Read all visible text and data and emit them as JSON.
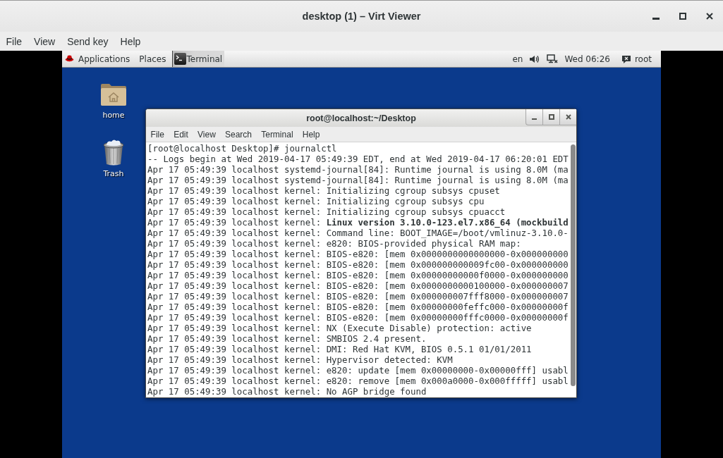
{
  "window": {
    "title": "desktop (1) – Virt Viewer",
    "menu": [
      "File",
      "View",
      "Send key",
      "Help"
    ]
  },
  "top_panel": {
    "applications": "Applications",
    "places": "Places",
    "task": "Terminal",
    "keyboard": "en",
    "clock": "Wed 06:26",
    "user": "root"
  },
  "desktop_icons": [
    {
      "kind": "folder",
      "label": "home"
    },
    {
      "kind": "trash",
      "label": "Trash"
    }
  ],
  "terminal": {
    "title": "root@localhost:~/Desktop",
    "menu": [
      "File",
      "Edit",
      "View",
      "Search",
      "Terminal",
      "Help"
    ],
    "lines": [
      "[root@localhost Desktop]# journalctl",
      "-- Logs begin at Wed 2019-04-17 05:49:39 EDT, end at Wed 2019-04-17 06:20:01 EDT",
      "Apr 17 05:49:39 localhost systemd-journal[84]: Runtime journal is using 8.0M (ma",
      "Apr 17 05:49:39 localhost systemd-journal[84]: Runtime journal is using 8.0M (ma",
      "Apr 17 05:49:39 localhost kernel: Initializing cgroup subsys cpuset",
      "Apr 17 05:49:39 localhost kernel: Initializing cgroup subsys cpu",
      "Apr 17 05:49:39 localhost kernel: Initializing cgroup subsys cpuacct",
      "Apr 17 05:49:39 localhost kernel: **Linux version 3.10.0-123.el7.x86_64 (mockbuild**",
      "Apr 17 05:49:39 localhost kernel: Command line: BOOT_IMAGE=/boot/vmlinuz-3.10.0-",
      "Apr 17 05:49:39 localhost kernel: e820: BIOS-provided physical RAM map:",
      "Apr 17 05:49:39 localhost kernel: BIOS-e820: [mem 0x0000000000000000-0x000000000",
      "Apr 17 05:49:39 localhost kernel: BIOS-e820: [mem 0x000000000009fc00-0x000000000",
      "Apr 17 05:49:39 localhost kernel: BIOS-e820: [mem 0x00000000000f0000-0x000000000",
      "Apr 17 05:49:39 localhost kernel: BIOS-e820: [mem 0x0000000000100000-0x000000007",
      "Apr 17 05:49:39 localhost kernel: BIOS-e820: [mem 0x000000007fff8000-0x000000007",
      "Apr 17 05:49:39 localhost kernel: BIOS-e820: [mem 0x00000000feffc000-0x00000000f",
      "Apr 17 05:49:39 localhost kernel: BIOS-e820: [mem 0x00000000fffc0000-0x00000000f",
      "Apr 17 05:49:39 localhost kernel: NX (Execute Disable) protection: active",
      "Apr 17 05:49:39 localhost kernel: SMBIOS 2.4 present.",
      "Apr 17 05:49:39 localhost kernel: DMI: Red Hat KVM, BIOS 0.5.1 01/01/2011",
      "Apr 17 05:49:39 localhost kernel: Hypervisor detected: KVM",
      "Apr 17 05:49:39 localhost kernel: e820: update [mem 0x00000000-0x00000fff] usabl",
      "Apr 17 05:49:39 localhost kernel: e820: remove [mem 0x000a0000-0x000fffff] usabl",
      "Apr 17 05:49:39 localhost kernel: No AGP bridge found"
    ]
  }
}
